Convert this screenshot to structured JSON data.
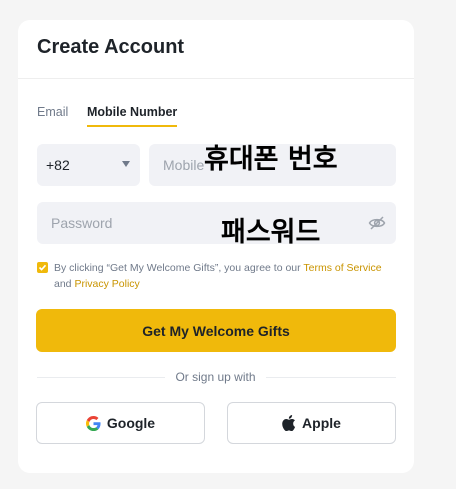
{
  "header": {
    "title": "Create Account"
  },
  "tabs": [
    {
      "label": "Email",
      "active": false
    },
    {
      "label": "Mobile Number",
      "active": true
    }
  ],
  "form": {
    "country_code": "+82",
    "mobile_placeholder": "Mobile",
    "mobile_overlay": "휴대폰 번호",
    "password_placeholder": "Password",
    "password_overlay": "패스워드",
    "password_toggle_icon": "eye-off-icon"
  },
  "terms": {
    "checked": true,
    "prefix": "By clicking “Get My Welcome Gifts”, you agree to our ",
    "terms_link": "Terms of Service",
    "and_text": " and ",
    "privacy_link": "Privacy Policy"
  },
  "primary_button": {
    "label": "Get My Welcome Gifts"
  },
  "divider": {
    "label": "Or sign up with"
  },
  "social": {
    "google_label": "Google",
    "apple_label": "Apple"
  },
  "colors": {
    "accent": "#f0b90b",
    "link": "#c99400",
    "input_bg": "#f1f2f6",
    "text_primary": "#1e2329",
    "text_secondary": "#707a8a"
  }
}
